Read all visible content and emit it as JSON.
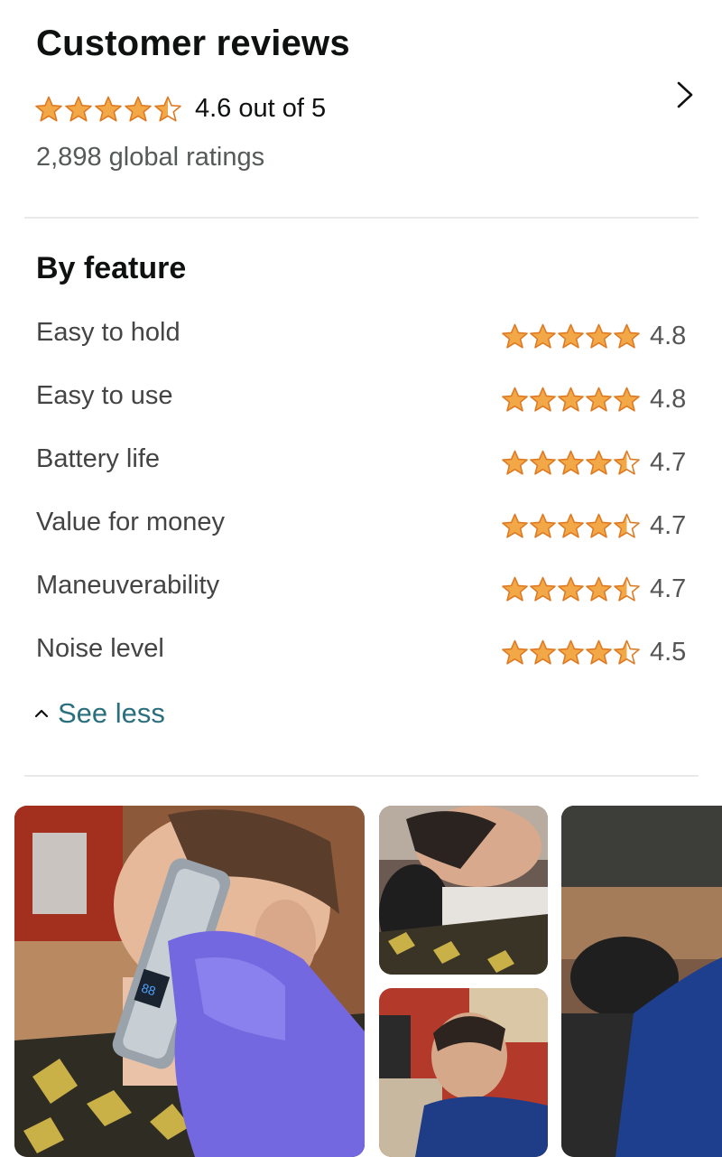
{
  "header": {
    "title": "Customer reviews",
    "rating_text": "4.6 out of 5",
    "rating_value": 4.6,
    "global_ratings": "2,898 global ratings"
  },
  "features": {
    "title": "By feature",
    "items": [
      {
        "name": "Easy to hold",
        "value": "4.8",
        "stars": 5
      },
      {
        "name": "Easy to use",
        "value": "4.8",
        "stars": 5
      },
      {
        "name": "Battery life",
        "value": "4.7",
        "stars": 4.5
      },
      {
        "name": "Value for money",
        "value": "4.7",
        "stars": 4.5
      },
      {
        "name": "Maneuverability",
        "value": "4.7",
        "stars": 4.5
      },
      {
        "name": "Noise level",
        "value": "4.5",
        "stars": 4.5
      }
    ],
    "toggle_label": "See less"
  },
  "colors": {
    "star": "#f3a847",
    "star_stroke": "#de7921",
    "link": "#2a6f7e"
  },
  "icons": [
    "star-icon",
    "chevron-right-icon",
    "chevron-up-icon"
  ]
}
